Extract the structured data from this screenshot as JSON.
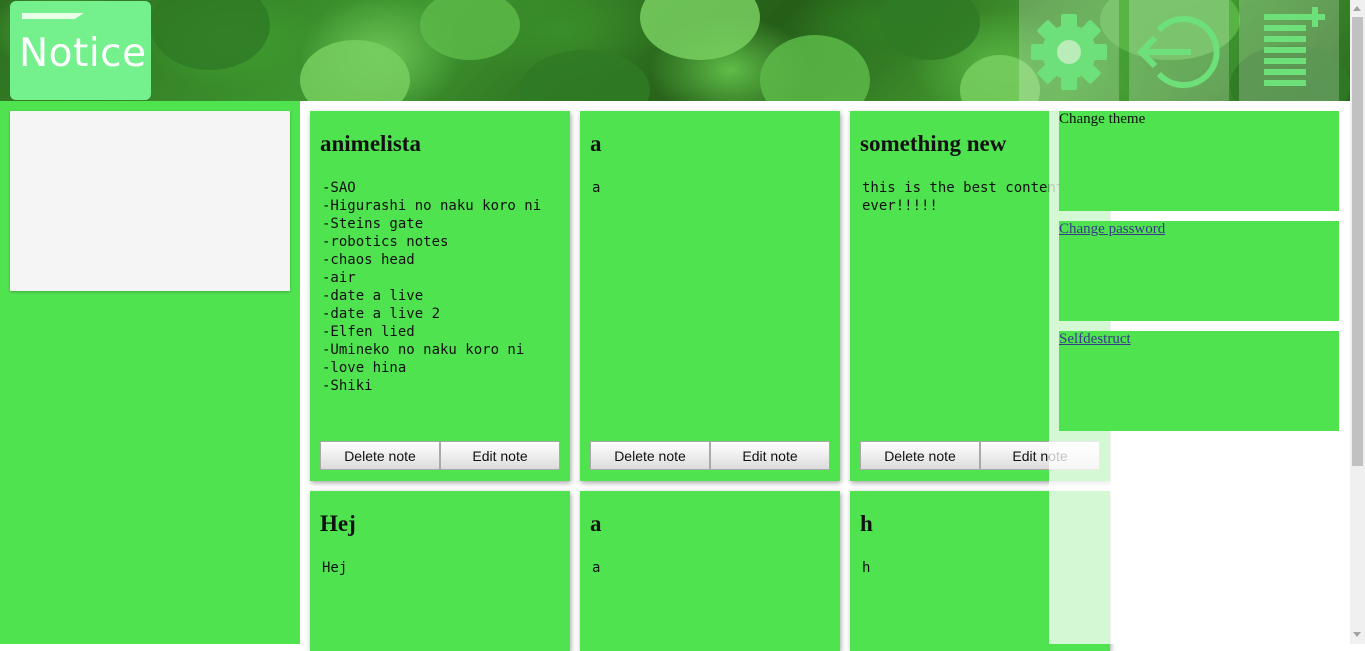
{
  "header": {
    "logo_text": "Notice",
    "buttons": [
      {
        "icon": "gear-icon"
      },
      {
        "icon": "logout-icon"
      },
      {
        "icon": "add-note-icon"
      }
    ]
  },
  "notes": [
    {
      "title": "animelista",
      "body": "-SAO\n-Higurashi no naku koro ni\n-Steins gate\n-robotics notes\n-chaos head\n-air\n-date a live\n-date a live 2\n-Elfen lied\n-Umineko no naku koro ni\n-love hina\n-Shiki",
      "delete_label": "Delete note",
      "edit_label": "Edit note"
    },
    {
      "title": "a",
      "body": "a",
      "delete_label": "Delete note",
      "edit_label": "Edit note"
    },
    {
      "title": "something new",
      "body": "this is the best content\never!!!!!",
      "delete_label": "Delete note",
      "edit_label": "Edit note"
    },
    {
      "title": "Hej",
      "body": "Hej"
    },
    {
      "title": "a",
      "body": "a"
    },
    {
      "title": "h",
      "body": "h"
    }
  ],
  "settings_panel": {
    "change_theme": "Change theme",
    "change_password": "Change password",
    "selfdestruct": "Selfdestruct"
  },
  "colors": {
    "note_green": "#50e350",
    "logo_green": "#74f08c",
    "icon_green": "#6ee07a"
  }
}
